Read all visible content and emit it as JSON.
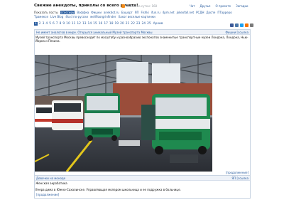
{
  "header": {
    "title": "Свежие анекдоты, приколы со всего рунета!",
    "subscribers": "Постов за сутки: 168",
    "nav": [
      "Чат",
      "Друзья",
      "О проекте",
      "Загадки"
    ]
  },
  "sources": {
    "label": "Показать посты",
    "items": [
      {
        "label": "ссоссиру",
        "active": true
      },
      {
        "label": "Воффка",
        "active": false
      },
      {
        "label": "Фишки",
        "active": false
      },
      {
        "label": "anekdot.ru",
        "active": false
      },
      {
        "label": "Башорг",
        "active": false
      },
      {
        "label": "ЯП",
        "active": false
      },
      {
        "label": "Fishki",
        "active": false
      },
      {
        "label": "ifun.ru",
        "active": false
      },
      {
        "label": "4pm.net",
        "active": false
      },
      {
        "label": "jokeofall.net",
        "active": false
      },
      {
        "label": "РСДН",
        "active": false
      },
      {
        "label": "Доспе",
        "active": false
      },
      {
        "label": "ПТарреро",
        "active": false
      }
    ]
  },
  "feeds": [
    "Трамексе",
    "Live Blog",
    "4kcd по-русски",
    "wellfloorgrinfinder",
    "Хахог веселые картинки"
  ],
  "pager": {
    "pages": [
      "1",
      "2",
      "3",
      "4",
      "5",
      "6",
      "7",
      "8",
      "9",
      "10",
      "11",
      "12",
      "13",
      "14",
      "15",
      "16",
      "17",
      "18",
      "19",
      "20",
      "21",
      "22",
      "23",
      "24",
      "25"
    ],
    "current": "1",
    "archive": "Архив"
  },
  "share_colors": [
    "#3b5998",
    "#4a76a8",
    "#1da1f2",
    "#f97400",
    "#7a7a7a"
  ],
  "posts": [
    {
      "head_left": "Не имеет аналогов в мире. Открылся уникальный Музей транспорта Москвы",
      "head_right": "Фишки [ссылка",
      "text": "Музей транспорта Москвы превосходит по масштабу и разнообразию экспонатов знаменитые транспортные музеи Лондона, Лондона, Нью-Йорка и Пекина.",
      "more": "[продолжение]"
    },
    {
      "head_left": "Девочки на моноде",
      "head_right": "ЯП [ссылка",
      "text1": "Женская акробатика",
      "text2": "Вчера дима в Южно-Сахалинске. Управляющая моледом школьница и ее подружка в больнице.",
      "more": "[продолжение]"
    }
  ]
}
